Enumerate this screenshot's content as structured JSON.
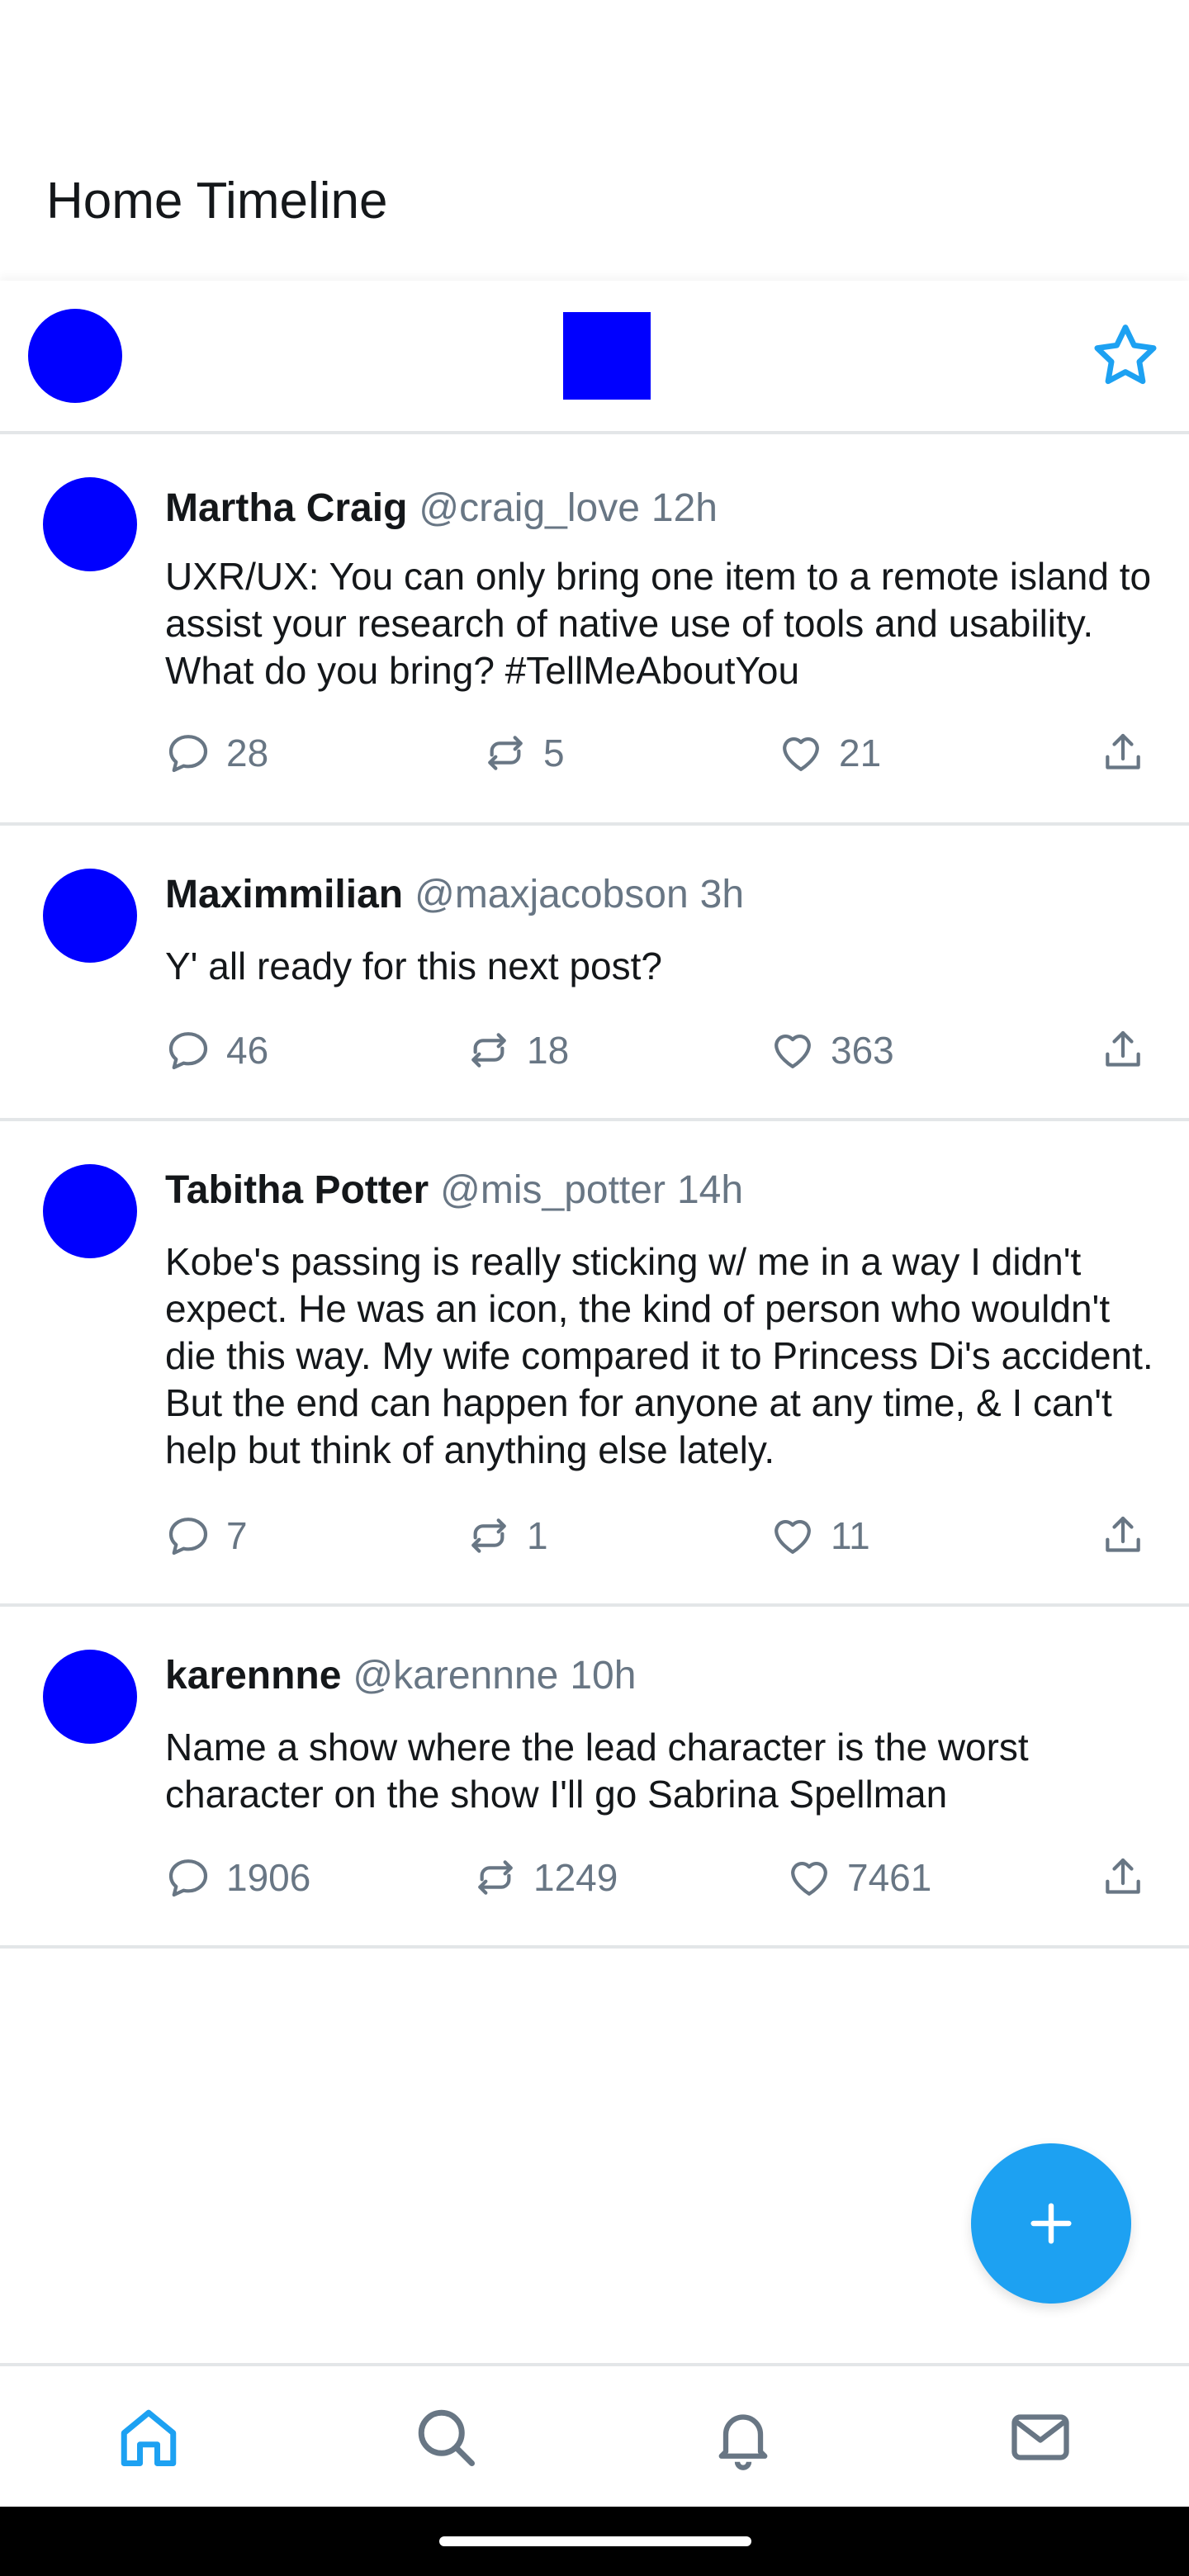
{
  "header": {
    "title": "Home Timeline"
  },
  "toolbar": {
    "avatar_icon": "avatar-icon",
    "logo_icon": "app-logo-icon",
    "star_icon": "star-icon"
  },
  "tweets": [
    {
      "name": "Martha Craig",
      "handle": "@craig_love",
      "time": "12h",
      "text": "UXR/UX: You can only bring one item to a remote island to assist your research of native use of tools and usability. What do you bring? #TellMeAboutYou",
      "replies": "28",
      "retweets": "5",
      "likes": "21"
    },
    {
      "name": "Maximmilian",
      "handle": "@maxjacobson",
      "time": "3h",
      "text": "Y' all ready for this next post?",
      "replies": "46",
      "retweets": "18",
      "likes": "363"
    },
    {
      "name": "Tabitha Potter",
      "handle": "@mis_potter",
      "time": "14h",
      "text": "Kobe's passing is really sticking w/ me in a way I didn't expect. He was an icon, the kind of person who wouldn't die this way. My wife compared it to Princess Di's accident. But the end can happen for anyone at any time, & I can't help but think of anything else lately.",
      "replies": "7",
      "retweets": "1",
      "likes": "11"
    },
    {
      "name": "karennne",
      "handle": "@karennne",
      "time": "10h",
      "text": "Name a show where the lead character is the worst character on the show I'll go Sabrina Spellman",
      "replies": "1906",
      "retweets": "1249",
      "likes": "7461"
    }
  ],
  "fab": {
    "icon": "plus-icon"
  },
  "bottom_nav": {
    "items": [
      "home-icon",
      "search-icon",
      "bell-icon",
      "mail-icon"
    ],
    "active": "home-icon"
  },
  "colors": {
    "accent": "#1da1f2",
    "placeholder": "#0000ff",
    "secondary_text": "#687684",
    "divider": "#e3e6e8",
    "text": "#14171a"
  }
}
